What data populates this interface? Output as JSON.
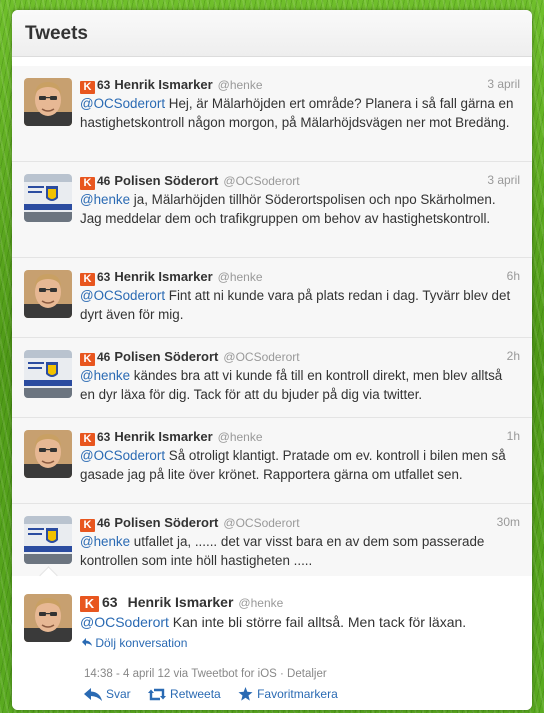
{
  "panel": {
    "title": "Tweets"
  },
  "tweets": [
    {
      "score": "63",
      "name": "Henrik Ismarker",
      "handle": "@henke",
      "time": "3 april",
      "mention": "@OCSoderort",
      "text": " Hej, är Mälarhöjden ert område? Planera i så fall gärna en hastighetskontroll någon morgon, på Mälarhöjdsvägen ner mot Bredäng."
    },
    {
      "score": "46",
      "name": "Polisen Söderort",
      "handle": "@OCSoderort",
      "time": "3 april",
      "mention": "@henke",
      "text": " ja, Mälarhöjden tillhör Söderortspolisen och npo Skärholmen. Jag meddelar dem och trafikgruppen om behov av hastighetskontroll."
    },
    {
      "score": "63",
      "name": "Henrik Ismarker",
      "handle": "@henke",
      "time": "6h",
      "mention": "@OCSoderort",
      "text": " Fint att ni kunde vara på plats redan i dag. Tyvärr blev det dyrt även för mig."
    },
    {
      "score": "46",
      "name": "Polisen Söderort",
      "handle": "@OCSoderort",
      "time": "2h",
      "mention": "@henke",
      "text": " kändes bra att vi kunde få till en kontroll direkt, men blev alltså en dyr läxa för dig. Tack för att du bjuder på dig via twitter."
    },
    {
      "score": "63",
      "name": "Henrik Ismarker",
      "handle": "@henke",
      "time": "1h",
      "mention": "@OCSoderort",
      "text": " Så otroligt klantigt. Pratade om ev. kontroll i bilen men så gasade jag på lite över krönet. Rapportera gärna om utfallet sen."
    },
    {
      "score": "46",
      "name": "Polisen Söderort",
      "handle": "@OCSoderort",
      "time": "30m",
      "mention": "@henke",
      "text": " utfallet ja, ...... det var visst bara en av dem som passerade kontrollen som inte höll hastigheten ....."
    }
  ],
  "focus": {
    "score": "63",
    "name": "Henrik Ismarker",
    "handle": "@henke",
    "mention": "@OCSoderort",
    "text": " Kan inte bli större fail alltså. Men tack för läxan.",
    "hide_conversation": "Dölj konversation",
    "meta": "14:38 - 4 april 12 via Tweetbot for iOS · Detaljer",
    "actions": {
      "reply": "Svar",
      "retweet": "Retweeta",
      "favorite": "Favoritmarkera"
    }
  },
  "icons": {
    "klout": "klout-icon",
    "reply": "reply-arrow-icon",
    "retweet": "retweet-icon",
    "favorite": "star-icon",
    "hide": "arrow-back-icon"
  },
  "colors": {
    "link": "#2a6ab3",
    "klout": "#e8561f",
    "background": "#5aab20"
  }
}
